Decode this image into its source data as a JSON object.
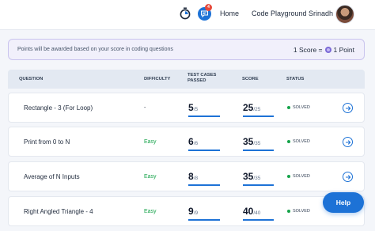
{
  "header": {
    "nav": [
      {
        "label": "Home"
      },
      {
        "label": "Code Playground"
      }
    ],
    "user_name": "Srinadh",
    "chat_badge": "4"
  },
  "notice": {
    "text": "Points will be awarded based on your score in coding questions",
    "score_text": "1 Score =",
    "point_text": "1 Point"
  },
  "table": {
    "headers": {
      "question": "QUESTION",
      "difficulty": "DIFFICULTY",
      "test_cases": "TEST CASES PASSED",
      "score": "SCORE",
      "status": "STATUS"
    },
    "rows": [
      {
        "question": "Rectangle - 3 (For Loop)",
        "difficulty": "-",
        "passed": "5",
        "total": "/5",
        "score": "25",
        "max": "/25",
        "status": "SOLVED"
      },
      {
        "question": "Print from 0 to N",
        "difficulty": "Easy",
        "passed": "6",
        "total": "/6",
        "score": "35",
        "max": "/35",
        "status": "SOLVED"
      },
      {
        "question": "Average of N Inputs",
        "difficulty": "Easy",
        "passed": "8",
        "total": "/8",
        "score": "35",
        "max": "/35",
        "status": "SOLVED"
      },
      {
        "question": "Right Angled Triangle - 4",
        "difficulty": "Easy",
        "passed": "9",
        "total": "/9",
        "score": "40",
        "max": "/40",
        "status": "SOLVED"
      }
    ]
  },
  "help_button": "Help",
  "colors": {
    "accent": "#1d72d6",
    "easy": "#16a34a",
    "solved_dot": "#16a34a"
  }
}
